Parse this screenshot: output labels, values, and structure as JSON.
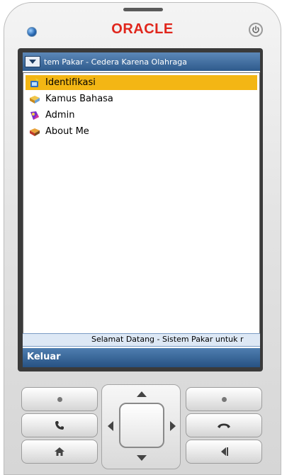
{
  "device": {
    "brand": "ORACLE"
  },
  "app": {
    "title": "tem Pakar - Cedera Karena Olahraga",
    "menu_items": [
      {
        "label": "Identifikasi",
        "icon": "wizard-icon",
        "selected": true
      },
      {
        "label": "Kamus Bahasa",
        "icon": "book-icon",
        "selected": false
      },
      {
        "label": "Admin",
        "icon": "admin-icon",
        "selected": false
      },
      {
        "label": "About Me",
        "icon": "info-book-icon",
        "selected": false
      }
    ],
    "ticker_text": "Selamat Datang - Sistem Pakar untuk r",
    "softkey_left": "Keluar"
  },
  "colors": {
    "titlebar": "#2e5a8c",
    "selection": "#f3b614",
    "softbar": "#275283",
    "brand": "#e0261c"
  }
}
